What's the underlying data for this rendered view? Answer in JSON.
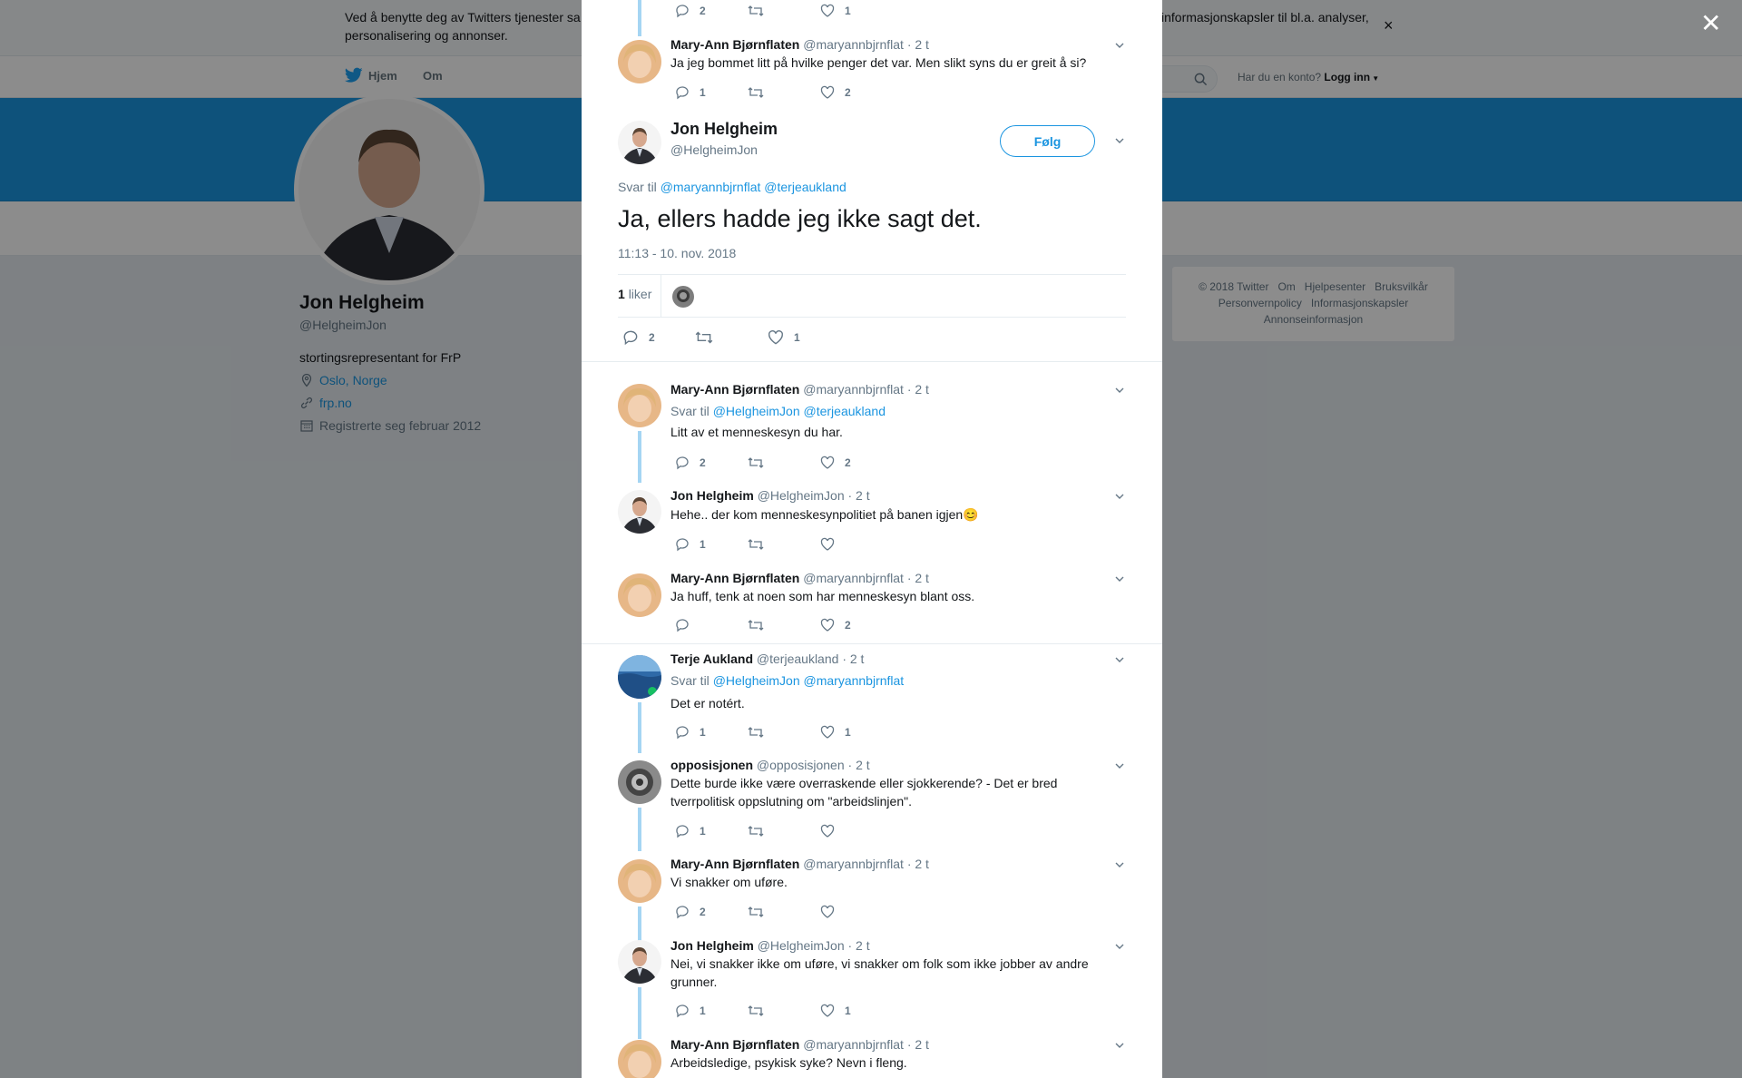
{
  "cookie_banner": {
    "text_left": "Ved å benytte deg av Twitters tjenester sa personalisering og annonser.",
    "text_right": "informasjonskapsler til bl.a. analyser,"
  },
  "topnav": {
    "home": "Hjem",
    "about": "Om",
    "login_prompt": "Har du en konto?",
    "login_link": "Logg inn"
  },
  "profile": {
    "name": "Jon Helgheim",
    "handle": "@HelgheimJon",
    "bio": "stortingsrepresentant for FrP",
    "location": "Oslo, Norge",
    "website": "frp.no",
    "joined": "Registrerte seg februar 2012"
  },
  "footer": [
    "© 2018 Twitter",
    "Om",
    "Hjelpesenter",
    "Bruksvilkår",
    "Personvernpolicy",
    "Informasjonskapsler",
    "Annonseinformasjon"
  ],
  "top_partial": {
    "replies": "2",
    "likes": "1"
  },
  "first_tweet": {
    "name": "Mary-Ann Bjørnflaten",
    "handle": "@maryannbjrnflat",
    "time": "· 2 t",
    "text": "Ja jeg bommet litt på hvilke penger det var. Men slikt syns du er greit å si?",
    "replies": "1",
    "likes": "2"
  },
  "main_tweet": {
    "name": "Jon Helgheim",
    "handle": "@HelgheimJon",
    "follow_label": "Følg",
    "reply_prefix": "Svar til",
    "mention1": "@maryannbjrnflat",
    "mention2": "@terjeaukland",
    "text": "Ja, ellers hadde jeg ikke sagt det.",
    "timestamp": "11:13 - 10. nov. 2018",
    "likes_count": "1",
    "likes_word": "liker",
    "replies": "2",
    "likes": "1"
  },
  "replies": [
    {
      "name": "Mary-Ann Bjørnflaten",
      "handle": "@maryannbjrnflat",
      "time": "· 2 t",
      "reply_prefix": "Svar til",
      "mention1": "@HelgheimJon",
      "mention2": "@terjeaukland",
      "text": "Litt av et menneskesyn du har.",
      "replies": "2",
      "likes": "2"
    },
    {
      "name": "Jon Helgheim",
      "handle": "@HelgheimJon",
      "time": "· 2 t",
      "text": "Hehe.. der kom menneskesynpolitiet på banen igjen",
      "emoji": "😊",
      "replies": "1",
      "likes": ""
    },
    {
      "name": "Mary-Ann Bjørnflaten",
      "handle": "@maryannbjrnflat",
      "time": "· 2 t",
      "text": "Ja huff, tenk at noen som har menneskesyn blant oss.",
      "replies": "",
      "likes": "2"
    },
    {
      "name": "Terje Aukland",
      "handle": "@terjeaukland",
      "time": "· 2 t",
      "reply_prefix": "Svar til",
      "mention1": "@HelgheimJon",
      "mention2": "@maryannbjrnflat",
      "text": "Det er notért.",
      "replies": "1",
      "likes": "1"
    },
    {
      "name": "opposisjonen",
      "handle": "@opposisjonen",
      "time": "· 2 t",
      "text": "Dette burde ikke være overraskende eller sjokkerende? - Det er bred tverrpolitisk oppslutning om \"arbeidslinjen\".",
      "replies": "1",
      "likes": ""
    },
    {
      "name": "Mary-Ann Bjørnflaten",
      "handle": "@maryannbjrnflat",
      "time": "· 2 t",
      "text": "Vi snakker om uføre.",
      "replies": "2",
      "likes": ""
    },
    {
      "name": "Jon Helgheim",
      "handle": "@HelgheimJon",
      "time": "· 2 t",
      "text": "Nei, vi snakker ikke om uføre, vi snakker om folk som ikke jobber av andre grunner.",
      "replies": "1",
      "likes": "1"
    },
    {
      "name": "Mary-Ann Bjørnflaten",
      "handle": "@maryannbjrnflat",
      "time": "· 2 t",
      "text": "Arbeidsledige, psykisk syke? Nevn i fleng."
    }
  ],
  "colors": {
    "twitter_blue": "#1b95e0",
    "thread_line": "#a5d5f3",
    "muted_text": "#657786"
  }
}
